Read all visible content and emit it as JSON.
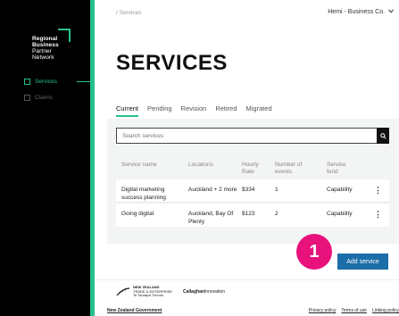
{
  "sidebar": {
    "logo": [
      "Regional",
      "Business",
      "Partner",
      "Network"
    ],
    "items": [
      {
        "label": "Services",
        "icon": "services-icon",
        "active": true
      },
      {
        "label": "Claims",
        "icon": "claims-icon",
        "active": false
      }
    ]
  },
  "header": {
    "breadcrumb": "/ Services",
    "org_select": "Hemi - Business Co."
  },
  "page_title": "SERVICES",
  "tabs": [
    "Current",
    "Pending",
    "Revision",
    "Retired",
    "Migrated"
  ],
  "search": {
    "placeholder": "Search services"
  },
  "table": {
    "headers": {
      "name": "Service name",
      "locations": "Locations",
      "rate": [
        "Hourly",
        "Rate"
      ],
      "events": [
        "Number of",
        "events"
      ],
      "fund": [
        "Service",
        "fund"
      ]
    },
    "rows": [
      {
        "name": "Digital marketing success planning",
        "locations": "Auckland + 2 more",
        "rate": "$334",
        "events": "1",
        "fund": "Capability"
      },
      {
        "name": "Going digital",
        "locations": "Auckland, Bay Of Plenty",
        "rate": "$123",
        "events": "2",
        "fund": "Capability"
      }
    ]
  },
  "step_badge": "1",
  "add_button": "Add service",
  "footer": {
    "nzte": [
      "NEW ZEALAND",
      "TRADE & ENTERPRISE",
      "Te Taurapa Tuhono"
    ],
    "callaghan": "Callaghan",
    "callaghan_rest": "Innovation",
    "gov": "New Zealand Government",
    "links": [
      "Privacy policy",
      "Terms of use",
      "Linking policy"
    ]
  },
  "colors": {
    "accent": "#27c08a",
    "badge": "#e8127c",
    "button": "#1b6ea8"
  }
}
